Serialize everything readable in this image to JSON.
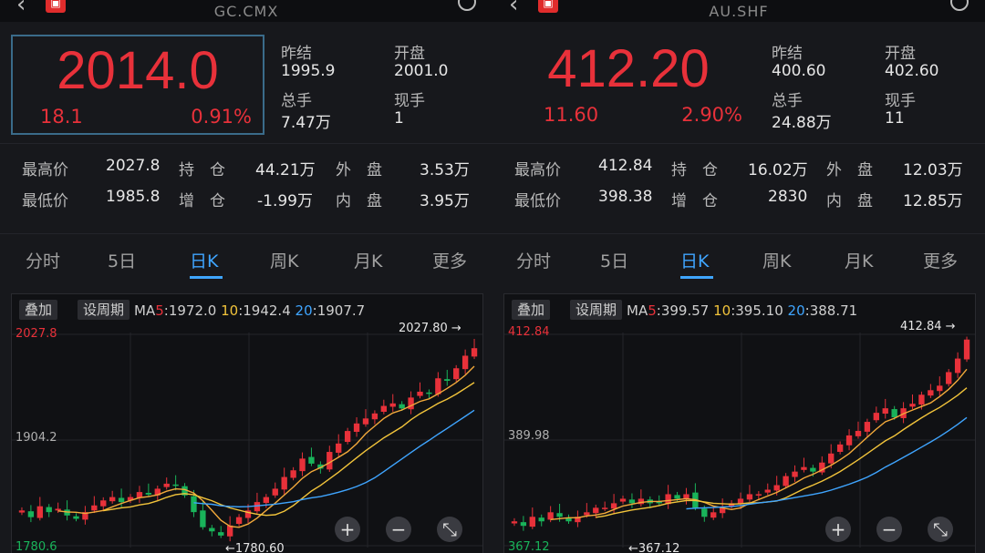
{
  "colors": {
    "up": "#e8313a",
    "down": "#19b35a",
    "ma5": "#f2a93b",
    "ma10": "#f2c43b",
    "ma20": "#3fa5ff"
  },
  "tabs": [
    "分时",
    "5日",
    "日K",
    "周K",
    "月K",
    "更多"
  ],
  "active_tab": "日K",
  "panels": [
    {
      "symbol": "GC.CMX",
      "price": "2014.0",
      "change": "18.1",
      "pct": "0.91%",
      "info": {
        "prev_close_label": "昨结",
        "prev_close": "1995.9",
        "open_label": "开盘",
        "open": "2001.0",
        "vol_label": "总手",
        "vol": "7.47万",
        "cur_label": "现手",
        "cur": "1"
      },
      "stats": {
        "high_label": "最高价",
        "high": "2027.8",
        "oi_label": "持　仓",
        "oi": "44.21万",
        "outer_label": "外　盘",
        "outer": "3.53万",
        "low_label": "最低价",
        "low": "1985.8",
        "add_label": "增　仓",
        "add": "-1.99万",
        "inner_label": "内　盘",
        "inner": "3.95万"
      },
      "chart": {
        "overlay": "叠加",
        "period": "设周期",
        "ma_label": "MA",
        "ma5_key": "5",
        "ma5": "1972.0",
        "ma10_key": "10",
        "ma10": "1942.4",
        "ma20_key": "20",
        "ma20": "1907.7",
        "y_top": "2027.8",
        "y_mid": "1904.2",
        "y_bottom": "1780.6",
        "high_marker": "2027.80 →",
        "low_marker": "←1780.60"
      }
    },
    {
      "symbol": "AU.SHF",
      "price": "412.20",
      "change": "11.60",
      "pct": "2.90%",
      "info": {
        "prev_close_label": "昨结",
        "prev_close": "400.60",
        "open_label": "开盘",
        "open": "402.60",
        "vol_label": "总手",
        "vol": "24.88万",
        "cur_label": "现手",
        "cur": "11"
      },
      "stats": {
        "high_label": "最高价",
        "high": "412.84",
        "oi_label": "持　仓",
        "oi": "16.02万",
        "outer_label": "外　盘",
        "outer": "12.03万",
        "low_label": "最低价",
        "low": "398.38",
        "add_label": "增　仓",
        "add": "2830",
        "inner_label": "内　盘",
        "inner": "12.85万"
      },
      "chart": {
        "overlay": "叠加",
        "period": "设周期",
        "ma_label": "MA",
        "ma5_key": "5",
        "ma5": "399.57",
        "ma10_key": "10",
        "ma10": "395.10",
        "ma20_key": "20",
        "ma20": "388.71",
        "y_top": "412.84",
        "y_mid": "389.98",
        "y_bottom": "367.12",
        "high_marker": "412.84 →",
        "low_marker": "←367.12"
      }
    }
  ],
  "zoom": {
    "plus": "+",
    "minus": "−",
    "expand": "⤡"
  },
  "chart_data": [
    {
      "type": "candlestick",
      "series": "GC.CMX daily",
      "ylim": [
        1780.6,
        2027.8
      ],
      "closes": [
        1820,
        1812,
        1825,
        1818,
        1822,
        1814,
        1810,
        1818,
        1826,
        1832,
        1836,
        1830,
        1836,
        1842,
        1839,
        1846,
        1852,
        1850,
        1838,
        1818,
        1800,
        1795,
        1790,
        1802,
        1812,
        1820,
        1830,
        1836,
        1846,
        1860,
        1868,
        1882,
        1876,
        1870,
        1890,
        1900,
        1915,
        1924,
        1930,
        1936,
        1945,
        1948,
        1942,
        1955,
        1962,
        1960,
        1978,
        1975,
        1990,
        2005,
        2014
      ]
    },
    {
      "type": "candlestick",
      "series": "AU.SHF daily",
      "ylim": [
        367.12,
        412.84
      ],
      "closes": [
        372,
        371,
        373,
        372,
        374,
        373,
        372,
        373,
        374,
        375,
        375,
        376,
        377,
        376,
        377,
        376,
        376,
        378,
        377,
        378,
        375,
        373,
        374,
        375,
        376,
        377,
        378,
        378,
        379,
        380,
        382,
        383,
        384,
        383,
        385,
        387,
        389,
        391,
        392,
        394,
        396,
        397,
        395,
        397,
        398,
        400,
        401,
        402,
        405,
        408,
        412.2
      ]
    }
  ]
}
